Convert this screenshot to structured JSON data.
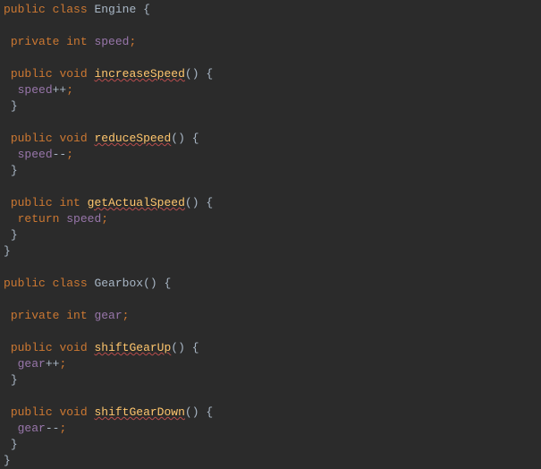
{
  "kw": {
    "public": "public",
    "private": "private",
    "class": "class",
    "void": "void",
    "int": "int",
    "return": "return"
  },
  "cls": {
    "engine": "Engine",
    "gearbox": "Gearbox"
  },
  "field": {
    "speed": "speed",
    "gear": "gear"
  },
  "method": {
    "increaseSpeed": "increaseSpeed",
    "reduceSpeed": "reduceSpeed",
    "getActualSpeed": "getActualSpeed",
    "shiftGearUp": "shiftGearUp",
    "shiftGearDown": "shiftGearDown"
  },
  "op": {
    "inc": "++",
    "dec": "--"
  },
  "p": {
    "obrace": "{",
    "cbrace": "}",
    "oparen": "(",
    "cparen": ")",
    "semi": ";",
    "sp": " ",
    "sp2": "  "
  }
}
